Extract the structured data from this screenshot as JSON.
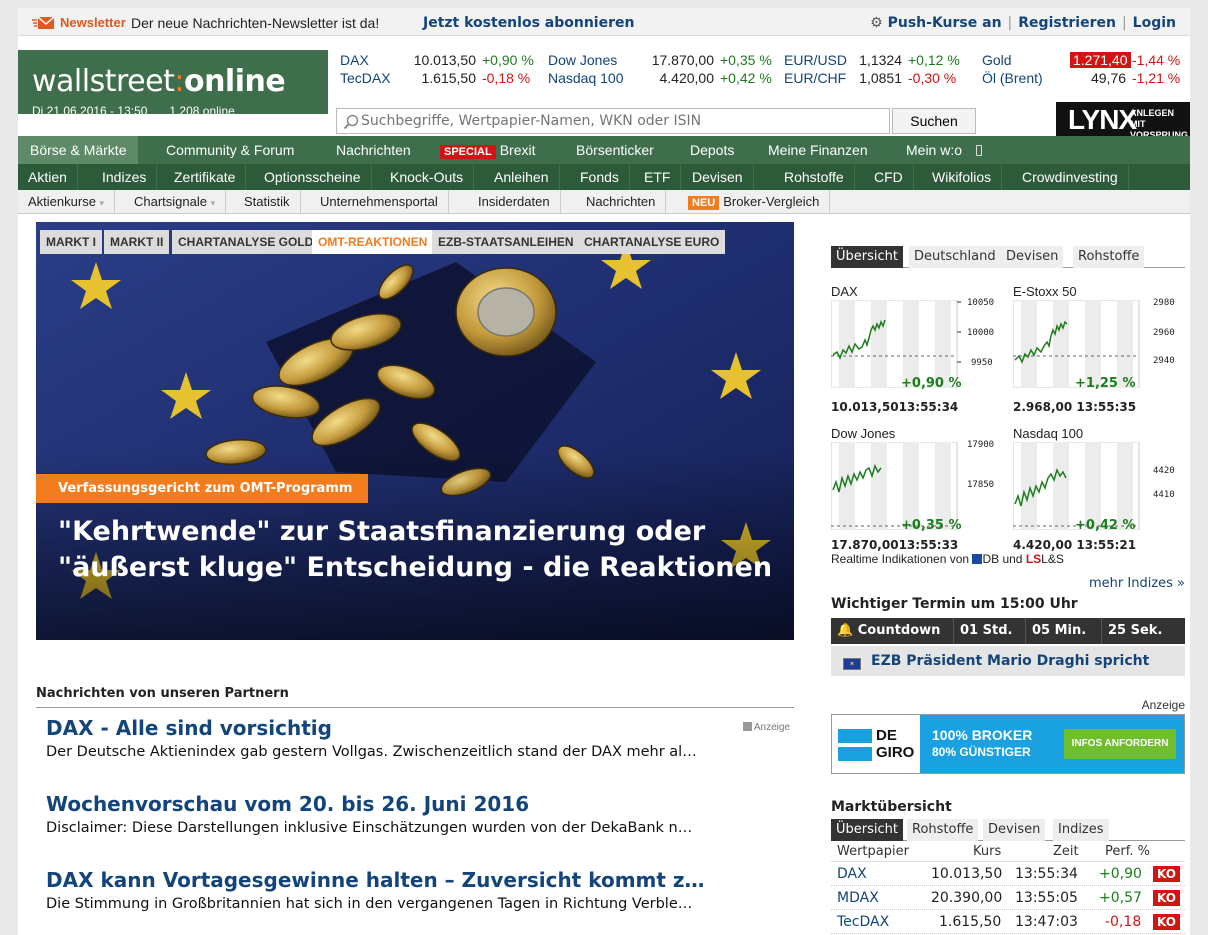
{
  "topbar": {
    "newsletter_label": "Newsletter",
    "newsletter_text": "Der neue Nachrichten-Newsletter ist da!",
    "newsletter_link": "Jetzt kostenlos abonnieren",
    "push_label": "Push-Kurse an",
    "register_label": "Registrieren",
    "login_label": "Login"
  },
  "logo": {
    "part1": "wallstreet",
    "part2": "online",
    "date": "Di 21.06.2016 - 13:50",
    "online": "1.208 online"
  },
  "quotes": [
    {
      "name": "DAX",
      "value": "10.013,50",
      "change": "+0,90 %",
      "dir": "pos"
    },
    {
      "name": "Dow Jones",
      "value": "17.870,00",
      "change": "+0,35 %",
      "dir": "pos"
    },
    {
      "name": "EUR/USD",
      "value": "1,1324",
      "change": "+0,12 %",
      "dir": "pos"
    },
    {
      "name": "Gold",
      "value": "1.271,40",
      "change": "-1,44 %",
      "dir": "neg"
    },
    {
      "name": "TecDAX",
      "value": "1.615,50",
      "change": "-0,18 %",
      "dir": "neg"
    },
    {
      "name": "Nasdaq 100",
      "value": "4.420,00",
      "change": "+0,42 %",
      "dir": "pos"
    },
    {
      "name": "EUR/CHF",
      "value": "1,0851",
      "change": "-0,30 %",
      "dir": "neg"
    },
    {
      "name": "Öl (Brent)",
      "value": "49,76",
      "change": "-1,21 %",
      "dir": "neg"
    }
  ],
  "search": {
    "placeholder": "Suchbegriffe, Wertpapier-Namen, WKN oder ISIN",
    "button": "Suchen"
  },
  "lynx": {
    "big": "LYNX",
    "line1": "ANLEGEN MIT",
    "line2": "VORSPRUNG"
  },
  "nav1": [
    "Börse & Märkte",
    "Community & Forum",
    "Nachrichten",
    "Brexit",
    "Börsenticker",
    "Depots",
    "Meine Finanzen",
    "Mein w:o"
  ],
  "nav1_special": "SPECIAL",
  "nav2": [
    "Aktien",
    "Indizes",
    "Zertifikate",
    "Optionsscheine",
    "Knock-Outs",
    "Anleihen",
    "Fonds",
    "ETF",
    "Devisen",
    "Rohstoffe",
    "CFD",
    "Wikifolios",
    "Crowdinvesting"
  ],
  "nav3": [
    "Aktienkurse",
    "Chartsignale",
    "Statistik",
    "Unternehmensportal",
    "Insiderdaten",
    "Nachrichten",
    "Broker-Vergleich"
  ],
  "nav3_new": "NEU",
  "hero": {
    "tabs": [
      "MARKT I",
      "MARKT II",
      "CHARTANALYSE GOLD",
      "OMT-REAKTIONEN",
      "EZB-STAATSANLEIHEN",
      "CHARTANALYSE EURO"
    ],
    "kicker": "Verfassungsgericht zum OMT-Programm",
    "headline": "\"Kehrtwende\" zur Staatsfinanzierung oder \"äußerst kluge\" Entscheidung - die Reaktionen"
  },
  "partner": {
    "title": "Nachrichten von unseren Partnern",
    "ad_label": "Anzeige",
    "items": [
      {
        "title": "DAX - Alle sind vorsichtig",
        "text": "Der Deutsche Aktienindex gab gestern Vollgas. Zwischenzeitlich stand der DAX mehr al…"
      },
      {
        "title": "Wochenvorschau vom 20. bis 26. Juni 2016",
        "text": "Disclaimer: Diese Darstellungen inklusive Einschätzungen wurden von der DekaBank n…"
      },
      {
        "title": "DAX kann Vortagesgewinne halten – Zuversicht kommt z…",
        "text": "Die Stimmung in Großbritannien hat sich in den vergangenen Tagen in Richtung Verble…"
      }
    ]
  },
  "right": {
    "tabs": [
      "Übersicht",
      "Deutschland",
      "Devisen",
      "Rohstoffe"
    ],
    "charts": [
      {
        "name": "DAX",
        "change": "+0,90 %",
        "value": "10.013,50",
        "time": "13:55:34",
        "ticks": [
          "10050",
          "10000",
          "9950"
        ]
      },
      {
        "name": "E-Stoxx 50",
        "change": "+1,25 %",
        "value": "2.968,00",
        "time": "13:55:35",
        "ticks": [
          "2980",
          "2960",
          "2940"
        ]
      },
      {
        "name": "Dow Jones",
        "change": "+0,35 %",
        "value": "17.870,00",
        "time": "13:55:33",
        "ticks": [
          "17900",
          "17850"
        ]
      },
      {
        "name": "Nasdaq 100",
        "change": "+0,42 %",
        "value": "4.420,00",
        "time": "13:55:21",
        "ticks": [
          "4420",
          "4410"
        ]
      }
    ],
    "realtime_text": "Realtime Indikationen von",
    "realtime_db": "DB",
    "realtime_and": "und",
    "realtime_ls": "L&S",
    "more_indices": "mehr Indizes »",
    "termin_title": "Wichtiger Termin um 15:00 Uhr",
    "countdown": {
      "label": "Countdown",
      "hours": "01 Std.",
      "minutes": "05 Min.",
      "seconds": "25 Sek."
    },
    "event": "EZB Präsident Mario Draghi spricht",
    "anzeige": "Anzeige",
    "degiro": {
      "logo1": "DE",
      "logo2": "GIRO",
      "line1": "100% BROKER",
      "line2": "80% GÜNSTIGER",
      "cta": "INFOS ANFORDERN"
    },
    "market_title": "Marktübersicht",
    "market_tabs": [
      "Übersicht",
      "Rohstoffe",
      "Devisen",
      "Indizes"
    ],
    "market_headers": {
      "paper": "Wertpapier",
      "price": "Kurs",
      "time": "Zeit",
      "perf": "Perf. %"
    },
    "market_rows": [
      {
        "name": "DAX",
        "price": "10.013,50",
        "time": "13:55:34",
        "perf": "+0,90",
        "dir": "pos",
        "ko": "KO"
      },
      {
        "name": "MDAX",
        "price": "20.390,00",
        "time": "13:55:05",
        "perf": "+0,57",
        "dir": "pos",
        "ko": "KO"
      },
      {
        "name": "TecDAX",
        "price": "1.615,50",
        "time": "13:47:03",
        "perf": "-0,18",
        "dir": "neg",
        "ko": "KO"
      }
    ]
  },
  "colors": {
    "brand_green": "#3f6e4c",
    "nav_dark": "#2d5a39",
    "accent_orange": "#f27c1e",
    "link_blue": "#13447a",
    "positive": "#1d7d1d",
    "negative": "#d21414"
  }
}
